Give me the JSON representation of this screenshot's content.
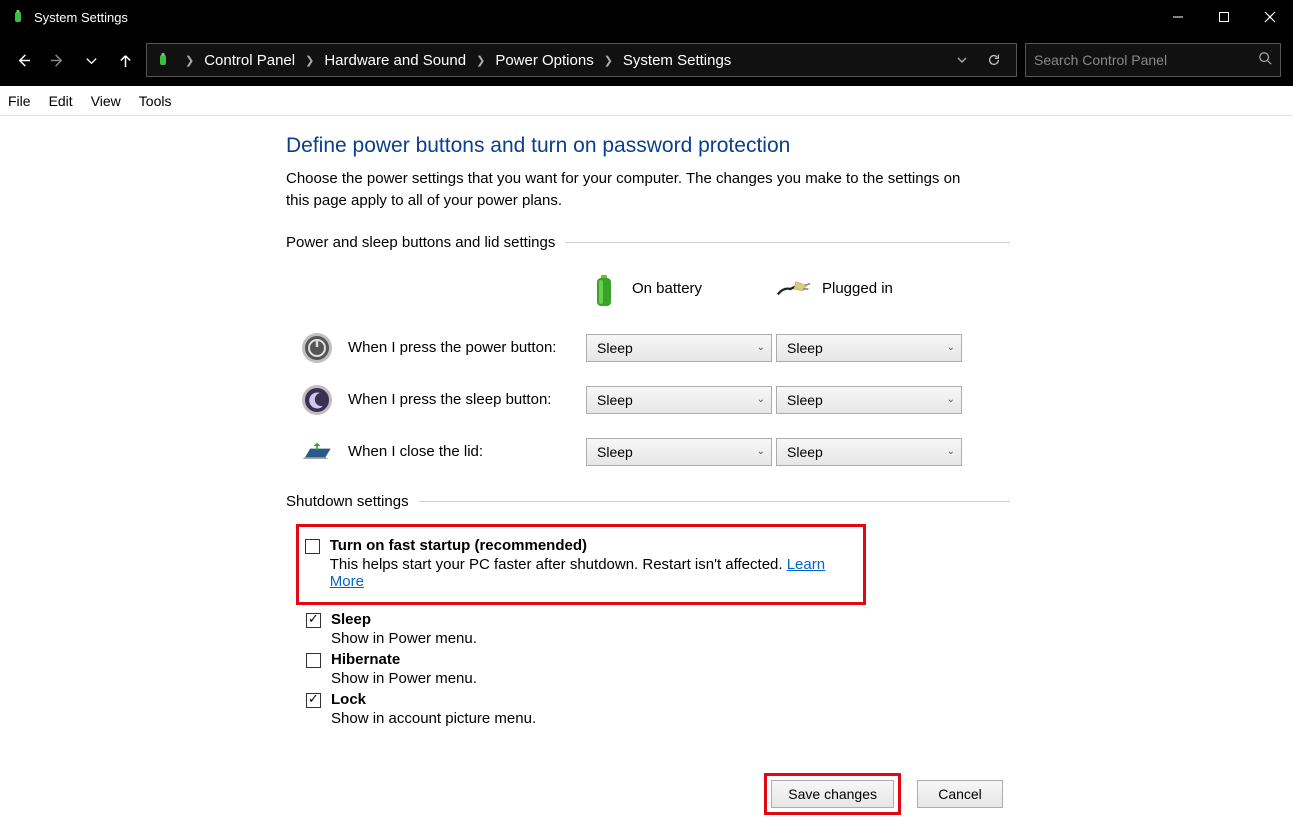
{
  "window": {
    "title": "System Settings"
  },
  "breadcrumbs": {
    "root": "Control Panel",
    "seg1": "Hardware and Sound",
    "seg2": "Power Options",
    "seg3": "System Settings"
  },
  "search": {
    "placeholder": "Search Control Panel"
  },
  "menu": {
    "file": "File",
    "edit": "Edit",
    "view": "View",
    "tools": "Tools"
  },
  "page": {
    "title": "Define power buttons and turn on password protection",
    "description": "Choose the power settings that you want for your computer. The changes you make to the settings on this page apply to all of your power plans."
  },
  "section1": {
    "label": "Power and sleep buttons and lid settings",
    "col_battery": "On battery",
    "col_plugged": "Plugged in",
    "rows": {
      "power": {
        "label": "When I press the power button:",
        "battery": "Sleep",
        "plugged": "Sleep"
      },
      "sleep": {
        "label": "When I press the sleep button:",
        "battery": "Sleep",
        "plugged": "Sleep"
      },
      "lid": {
        "label": "When I close the lid:",
        "battery": "Sleep",
        "plugged": "Sleep"
      }
    }
  },
  "section2": {
    "label": "Shutdown settings",
    "fast": {
      "title": "Turn on fast startup (recommended)",
      "sub": "This helps start your PC faster after shutdown. Restart isn't affected. ",
      "link": "Learn More",
      "checked": false
    },
    "sleep": {
      "title": "Sleep",
      "sub": "Show in Power menu.",
      "checked": true
    },
    "hib": {
      "title": "Hibernate",
      "sub": "Show in Power menu.",
      "checked": false
    },
    "lock": {
      "title": "Lock",
      "sub": "Show in account picture menu.",
      "checked": true
    }
  },
  "buttons": {
    "save": "Save changes",
    "cancel": "Cancel"
  }
}
